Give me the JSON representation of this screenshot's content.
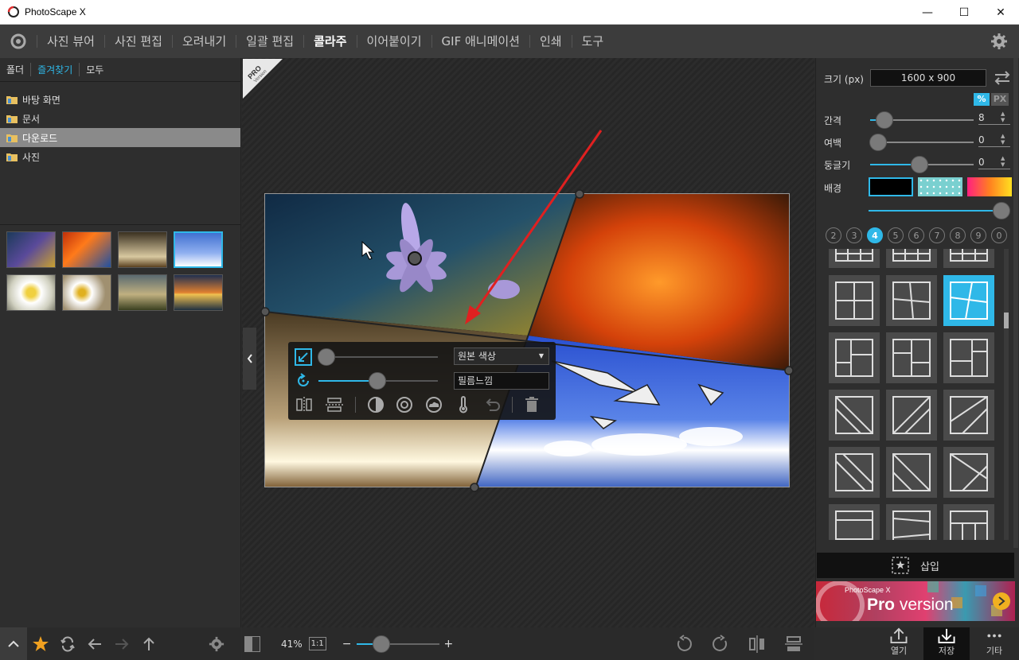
{
  "window": {
    "title": "PhotoScape X",
    "minimize": "—",
    "maximize": "☐",
    "close": "✕"
  },
  "menu": {
    "items": [
      "사진 뷰어",
      "사진 편집",
      "오려내기",
      "일괄 편집",
      "콜라주",
      "이어붙이기",
      "GIF 애니메이션",
      "인쇄",
      "도구"
    ],
    "active_index": 4
  },
  "left": {
    "tabs": [
      "폴더",
      "즐겨찾기",
      "모두"
    ],
    "selected_tab": 1,
    "tree": [
      "바탕 화면",
      "문서",
      "다운로드",
      "사진"
    ],
    "selected_tree": 2
  },
  "badge": {
    "line1": "PRO",
    "line2": "Version"
  },
  "overlay": {
    "color_select": "원본 색상",
    "filter_field": "필름느낌"
  },
  "bottom": {
    "zoom": "41%",
    "one_to_one": "1:1",
    "minus": "−",
    "plus": "+"
  },
  "right": {
    "size_label": "크기 (px)",
    "size_value": "1600 x 900",
    "unit_pct": "%",
    "unit_px": "PX",
    "spacing_label": "간격",
    "spacing_value": "8",
    "margin_label": "여백",
    "margin_value": "0",
    "round_label": "둥글기",
    "round_value": "0",
    "bg_label": "배경",
    "counts": [
      "2",
      "3",
      "4",
      "5",
      "6",
      "7",
      "8",
      "9",
      "0"
    ],
    "selected_count": 2,
    "insert_label": "삽입",
    "promo_small": "PhotoScape X",
    "promo_pro": "Pro",
    "promo_version": " version"
  },
  "actions": {
    "open": "열기",
    "save": "저장",
    "more": "기타"
  },
  "colors": {
    "accent": "#2fb8e8",
    "background": "#2b2b2b"
  }
}
